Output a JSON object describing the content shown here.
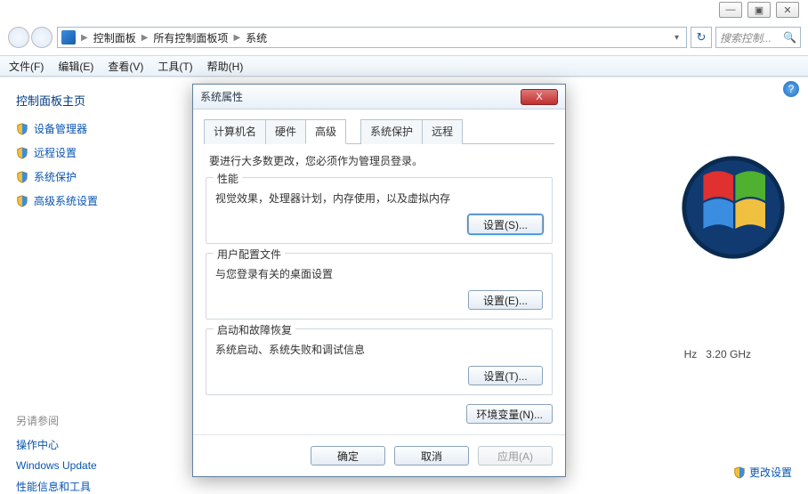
{
  "chrome": {
    "min": "—",
    "max": "▣",
    "close": "✕"
  },
  "breadcrumb": {
    "items": [
      "控制面板",
      "所有控制面板项",
      "系统"
    ],
    "sep": "▶",
    "drop": "▾"
  },
  "refresh_glyph": "↻",
  "search": {
    "placeholder": "搜索控制...",
    "mag": "🔍"
  },
  "menu": [
    "文件(F)",
    "编辑(E)",
    "查看(V)",
    "工具(T)",
    "帮助(H)"
  ],
  "sidebar": {
    "title": "控制面板主页",
    "links": [
      "设备管理器",
      "远程设置",
      "系统保护",
      "高级系统设置"
    ],
    "see_also_title": "另请参阅",
    "see_also": [
      "操作中心",
      "Windows Update",
      "性能信息和工具"
    ]
  },
  "help_glyph": "?",
  "cpu": {
    "hz": "Hz",
    "ghz": "3.20 GHz"
  },
  "change_settings": {
    "label": "更改设置",
    "shield": true
  },
  "dialog": {
    "title": "系统属性",
    "close": "X",
    "tabs": [
      "计算机名",
      "硬件",
      "高级",
      "系统保护",
      "远程"
    ],
    "active_tab": 2,
    "admin_note": "要进行大多数更改，您必须作为管理员登录。",
    "groups": [
      {
        "title": "性能",
        "desc": "视觉效果，处理器计划，内存使用，以及虚拟内存",
        "btn": "设置(S)...",
        "def": true
      },
      {
        "title": "用户配置文件",
        "desc": "与您登录有关的桌面设置",
        "btn": "设置(E)...",
        "def": false
      },
      {
        "title": "启动和故障恢复",
        "desc": "系统启动、系统失败和调试信息",
        "btn": "设置(T)...",
        "def": false
      }
    ],
    "env_btn": "环境变量(N)...",
    "footer": {
      "ok": "确定",
      "cancel": "取消",
      "apply": "应用(A)"
    }
  }
}
